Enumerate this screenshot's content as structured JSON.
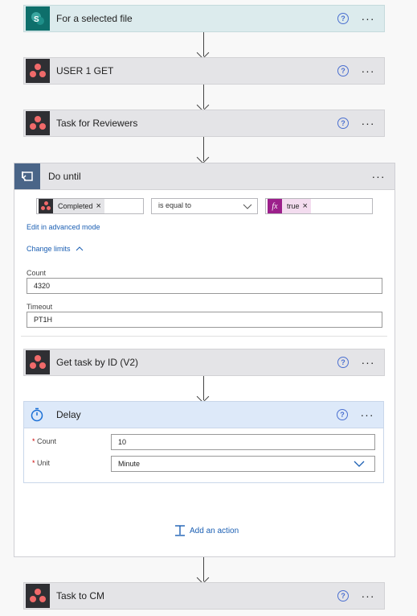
{
  "cards": {
    "trigger": {
      "title": "For a selected file"
    },
    "user1": {
      "title": "USER 1 GET"
    },
    "reviewers": {
      "title": "Task for Reviewers"
    },
    "gettask": {
      "title": "Get task by ID (V2)"
    },
    "taskcm": {
      "title": "Task to CM"
    }
  },
  "help_glyph": "?",
  "more_glyph": "···",
  "do_until": {
    "title": "Do until",
    "condition": {
      "left_token": "Completed",
      "operator": "is equal to",
      "right_token": "true",
      "right_token_icon": "fx",
      "remove_glyph": "×"
    },
    "edit_advanced": "Edit in advanced mode",
    "change_limits": "Change limits",
    "count_label": "Count",
    "count_value": "4320",
    "timeout_label": "Timeout",
    "timeout_value": "PT1H",
    "add_action": "Add an action"
  },
  "delay": {
    "title": "Delay",
    "required_mark": "*",
    "count_label": "Count",
    "count_value": "10",
    "unit_label": "Unit",
    "unit_value": "Minute"
  },
  "colors": {
    "sharepoint": "#0e6f6b",
    "asana_bg": "#2f2f33",
    "asana_dots": "#f06a6a",
    "link": "#1b5fb3",
    "loop_icon_bg": "#4a6588",
    "delay_header": "#dde9f9",
    "fx_chip": "#9c1f8b"
  }
}
